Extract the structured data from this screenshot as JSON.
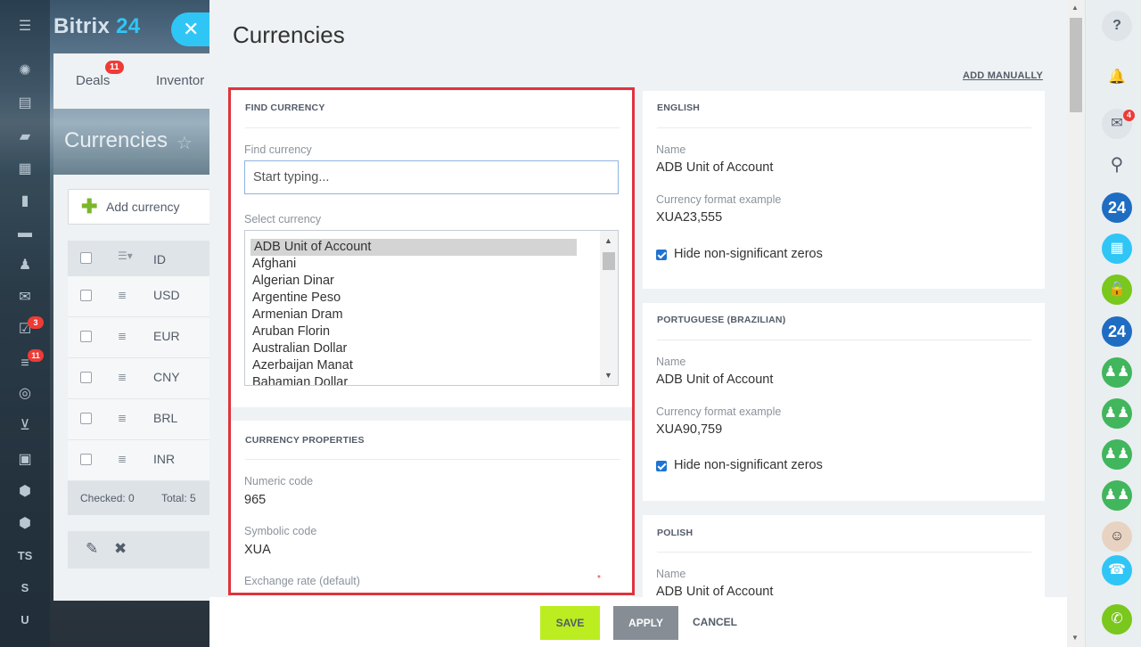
{
  "app": {
    "logo_main": "Bitrix",
    "logo_accent": "24",
    "close_icon": "✕"
  },
  "left_sidebar": {
    "badges": [
      "3",
      "11"
    ],
    "labels": [
      "TS",
      "S",
      "U"
    ]
  },
  "background_page": {
    "tabs": [
      {
        "label": "Deals",
        "badge": "11"
      },
      {
        "label": "Inventor"
      }
    ],
    "title": "Currencies",
    "add_button_label": "Add currency",
    "grid": {
      "id_header": "ID",
      "rows": [
        "USD",
        "EUR",
        "CNY",
        "BRL",
        "INR"
      ],
      "checked_label": "Checked: 0",
      "total_label": "Total: 5"
    }
  },
  "panel": {
    "title": "Currencies",
    "add_manually": "ADD MANUALLY",
    "find_section": {
      "header": "FIND CURRENCY",
      "find_label": "Find currency",
      "find_placeholder": "Start typing...",
      "select_label": "Select currency",
      "options": [
        "ADB Unit of Account",
        "Afghani",
        "Algerian Dinar",
        "Argentine Peso",
        "Armenian Dram",
        "Aruban Florin",
        "Australian Dollar",
        "Azerbaijan Manat",
        "Bahamian Dollar"
      ],
      "selected": "ADB Unit of Account"
    },
    "properties": {
      "header": "CURRENCY PROPERTIES",
      "numeric_label": "Numeric code",
      "numeric_value": "965",
      "symbolic_label": "Symbolic code",
      "symbolic_value": "XUA",
      "rate_label": "Exchange rate (default)",
      "required_mark": "*"
    },
    "languages": [
      {
        "header": "ENGLISH",
        "name_label": "Name",
        "name_value": "ADB Unit of Account",
        "format_label": "Currency format example",
        "format_value": "XUA23,555",
        "hide_zeros": "Hide non-significant zeros"
      },
      {
        "header": "PORTUGUESE (BRAZILIAN)",
        "name_label": "Name",
        "name_value": "ADB Unit of Account",
        "format_label": "Currency format example",
        "format_value": "XUA90,759",
        "hide_zeros": "Hide non-significant zeros"
      },
      {
        "header": "POLISH",
        "name_label": "Name",
        "name_value": "ADB Unit of Account"
      }
    ]
  },
  "footer": {
    "save": "SAVE",
    "apply": "APPLY",
    "cancel": "CANCEL"
  },
  "right_sidebar": {
    "help_icon": "?",
    "chat_badge": "4",
    "num_label": "24"
  },
  "colors": {
    "accent": "#2fc6f6",
    "save_button": "#bbed21",
    "apply_button": "#868d95",
    "highlight": "#e0333d",
    "checkbox": "#1f74d1"
  }
}
